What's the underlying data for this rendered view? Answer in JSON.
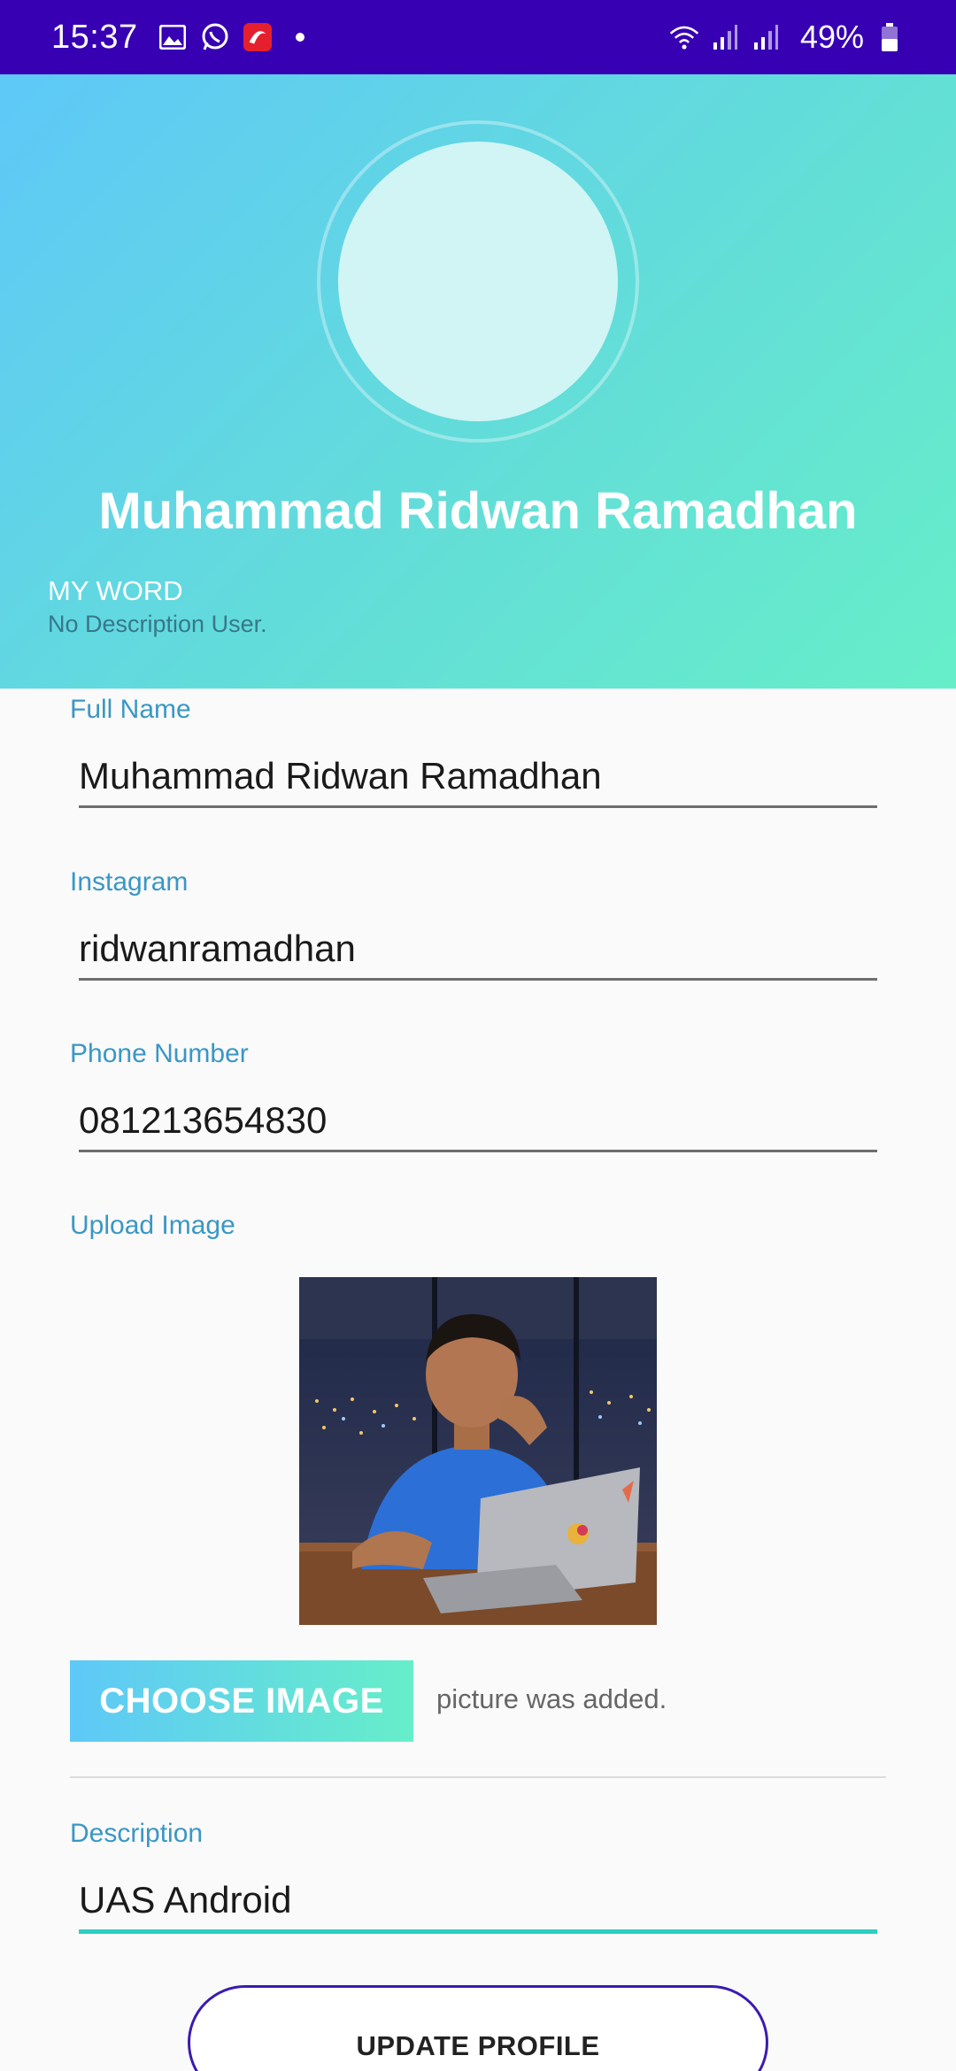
{
  "status_bar": {
    "time": "15:37",
    "battery": "49%",
    "icons_left": [
      "gallery-icon",
      "whatsapp-icon",
      "telkomsel-icon",
      "dot-icon"
    ],
    "icons_right": [
      "wifi-icon",
      "signal-icon",
      "signal-icon",
      "battery-icon"
    ]
  },
  "header": {
    "name": "Muhammad Ridwan Ramadhan",
    "my_word_label": "MY WORD",
    "my_word_desc": "No Description User."
  },
  "form": {
    "full_name": {
      "label": "Full Name",
      "value": "Muhammad Ridwan Ramadhan"
    },
    "instagram": {
      "label": "Instagram",
      "value": "ridwanramadhan"
    },
    "phone": {
      "label": "Phone Number",
      "value": "081213654830"
    },
    "upload_image_label": "Upload Image",
    "choose_image_button": "CHOOSE IMAGE",
    "picture_status": "picture was added.",
    "description": {
      "label": "Description",
      "value": "UAS Android"
    }
  },
  "update_button": "UPDATE PROFILE",
  "colors": {
    "status_bar": "#3700b3",
    "gradient_start": "#5ec8f8",
    "gradient_end": "#66eec9",
    "label": "#3a97c4",
    "active_underline": "#2ccfc2",
    "update_border": "#3b1bb0"
  }
}
